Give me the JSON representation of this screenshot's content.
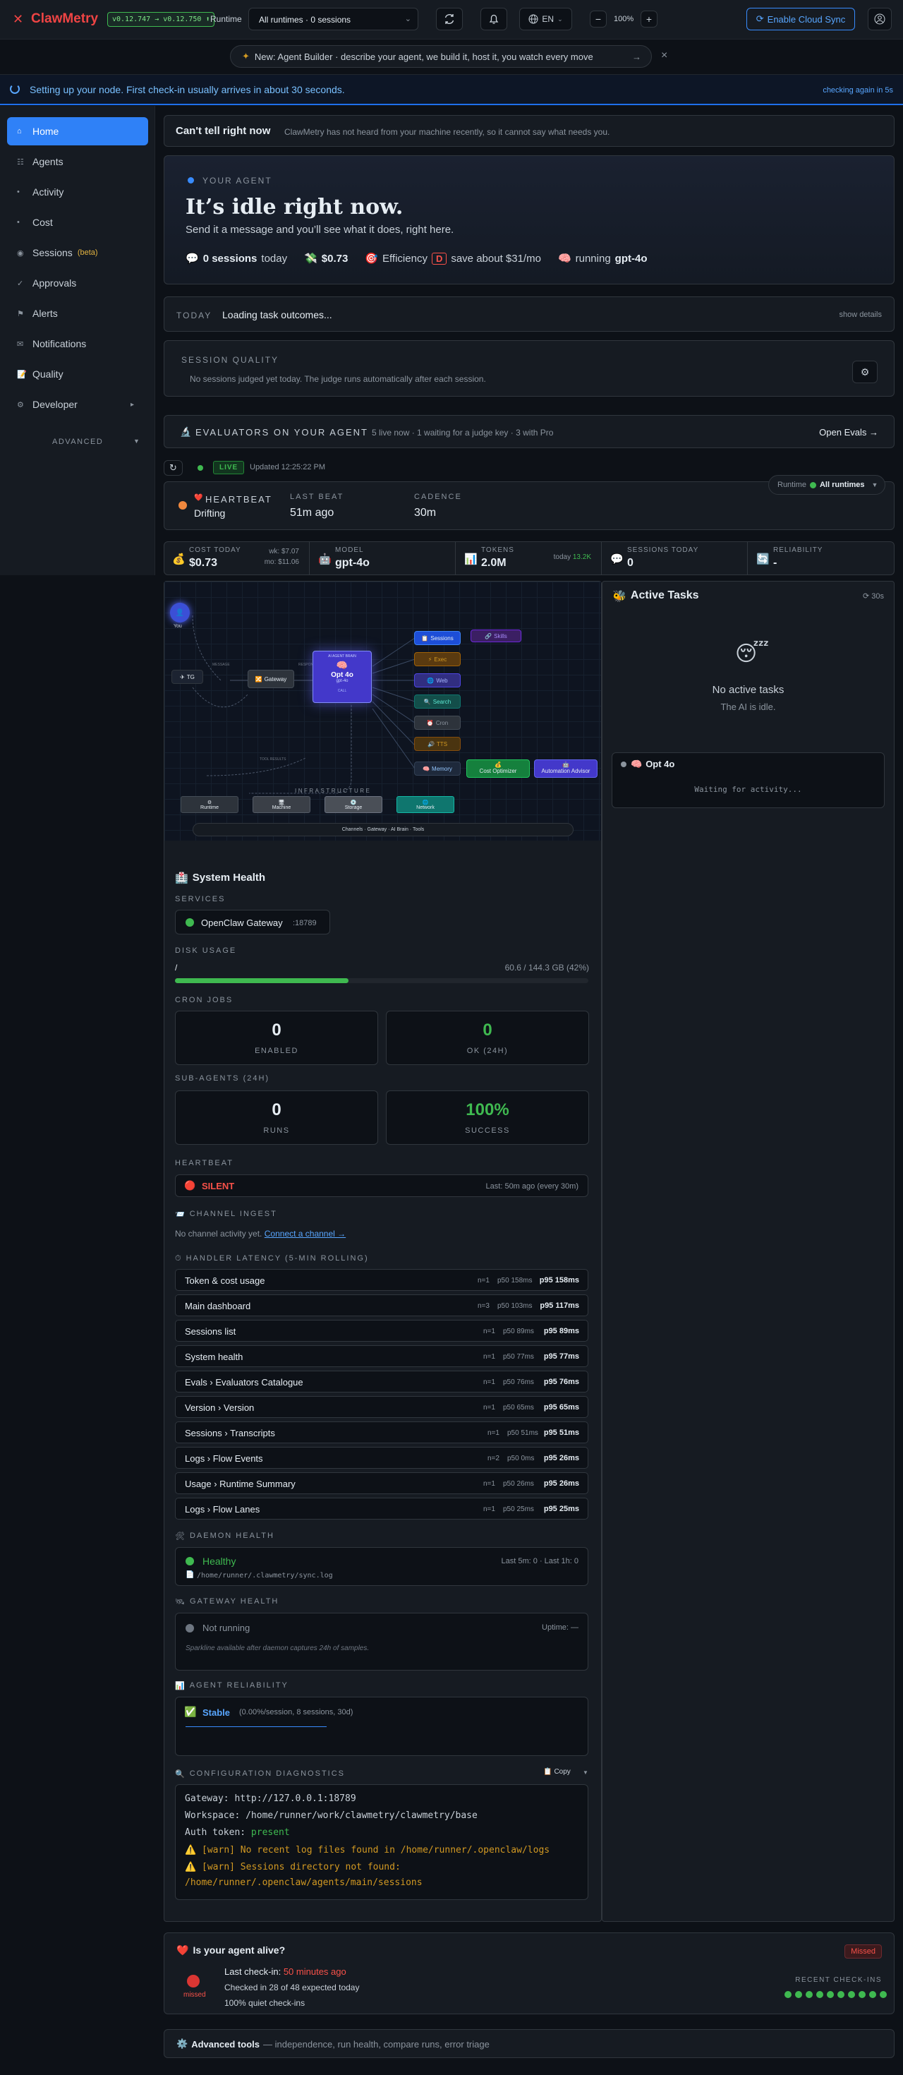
{
  "topbar": {
    "logo": "ClawMetry",
    "version": "v0.12.747 → v0.12.750 ⬆",
    "runtime_label": "Runtime",
    "runtime_select": "All runtimes · 0 sessions",
    "lang": "EN",
    "zoom": "100%",
    "zoom_minus": "−",
    "zoom_plus": "+",
    "cloud_sync": "Enable Cloud Sync"
  },
  "announce": {
    "text": "New: Agent Builder · describe your agent, we build it, host it, you watch every move",
    "arrow": "→",
    "close": "×"
  },
  "setup": {
    "text": "Setting up your node. First check-in usually arrives in about 30 seconds.",
    "right": "checking again in 5s"
  },
  "sidebar": {
    "items": [
      {
        "label": "Home",
        "icon": "home-icon",
        "glyph": "⌂"
      },
      {
        "label": "Agents",
        "icon": "agents-icon",
        "glyph": "☷"
      },
      {
        "label": "Activity",
        "icon": "activity-icon",
        "glyph": "•"
      },
      {
        "label": "Cost",
        "icon": "cost-icon",
        "glyph": "•"
      },
      {
        "label": "Sessions",
        "icon": "sessions-icon",
        "glyph": "◉",
        "badge": "(beta)"
      },
      {
        "label": "Approvals",
        "icon": "check-icon",
        "glyph": "✓"
      },
      {
        "label": "Alerts",
        "icon": "flag-icon",
        "glyph": "⚑"
      },
      {
        "label": "Notifications",
        "icon": "mail-icon",
        "glyph": "✉"
      },
      {
        "label": "Quality",
        "icon": "memo-icon",
        "glyph": "📝"
      },
      {
        "label": "Developer",
        "icon": "gear-icon",
        "glyph": "⚙"
      }
    ],
    "advanced": "ADVANCED"
  },
  "cant_tell": {
    "title": "Can't tell right now",
    "desc": "ClawMetry has not heard from your machine recently, so it cannot say what needs you."
  },
  "agent": {
    "label": "YOUR AGENT",
    "headline": "It’s idle right now.",
    "sub": "Send it a message and you’ll see what it does, right here.",
    "sessions_count": "0 sessions",
    "sessions_suffix": "today",
    "cost": "$0.73",
    "efficiency_label": "Efficiency",
    "efficiency_grade": "D",
    "save": "save about $31/mo",
    "running_label": "running",
    "model": "gpt-4o"
  },
  "today": {
    "label": "TODAY",
    "text": "Loading task outcomes...",
    "link": "show details"
  },
  "quality": {
    "label": "SESSION QUALITY",
    "text": "No sessions judged yet today. The judge runs automatically after each session."
  },
  "evaluators": {
    "label": "EVALUATORS ON YOUR AGENT",
    "desc": "5 live now · 1 waiting for a judge key · 3 with Pro",
    "link": "Open Evals →"
  },
  "status": {
    "live": "LIVE",
    "updated": "Updated 12:25:22 PM"
  },
  "heartbeat": {
    "label": "HEARTBEAT",
    "state": "Drifting",
    "last_beat_label": "LAST BEAT",
    "last_beat": "51m ago",
    "cadence_label": "CADENCE",
    "cadence": "30m",
    "runtime_label": "Runtime",
    "runtime_value": "All runtimes"
  },
  "stats": {
    "cost_label": "COST TODAY",
    "cost": "$0.73",
    "cost_wk": "wk: $7.07",
    "cost_mo": "mo: $11.06",
    "model_label": "MODEL",
    "model": "gpt-4o",
    "tokens_label": "TOKENS",
    "tokens": "2.0M",
    "tokens_today_label": "today",
    "tokens_today": "13.2K",
    "sessions_label": "SESSIONS TODAY",
    "sessions": "0",
    "reliability_label": "RELIABILITY",
    "reliability": "-"
  },
  "flow": {
    "user": "You",
    "tg": "TG",
    "gateway": "Gateway",
    "brain_caption": "AI AGENT BRAIN",
    "brain": "Opt 4o",
    "brain_model": "gpt-4o",
    "brain_link": "CALL",
    "gateway_caption": "MESSAGE",
    "brain_in": "RESPONSE",
    "bottom_caption": "TOOL RESULTS",
    "tools": [
      "Sessions",
      "Exec",
      "Web",
      "Search",
      "Cron",
      "TTS",
      "Memory"
    ],
    "extra_tool": "Skills",
    "cost_opt": "Cost Optimizer",
    "automation": "Automation Advisor",
    "infra_label": "INFRASTRUCTURE",
    "infra": [
      "Runtime",
      "Machine",
      "Storage",
      "Network"
    ],
    "legend": "Channels · Gateway · AI Brain · Tools"
  },
  "active_tasks": {
    "title": "Active Tasks",
    "refresh": "30s",
    "empty": "No active tasks",
    "empty_sub": "The AI is idle.",
    "agent": "Opt 4o",
    "waiting": "Waiting for activity..."
  },
  "system_health": {
    "title": "System Health",
    "services_label": "SERVICES",
    "service_name": "OpenClaw Gateway",
    "service_port": ":18789",
    "disk_label": "DISK USAGE",
    "disk_path": "/",
    "disk_value": "60.6 / 144.3 GB (42%)",
    "disk_percent": 42,
    "cron_label": "CRON JOBS",
    "cron_enabled": "0",
    "cron_enabled_label": "ENABLED",
    "cron_ok": "0",
    "cron_ok_label": "OK (24H)",
    "sub_label": "SUB-AGENTS (24H)",
    "sub_runs": "0",
    "sub_runs_label": "RUNS",
    "sub_success": "100%",
    "sub_success_label": "SUCCESS",
    "hb_label": "HEARTBEAT",
    "hb_state": "SILENT",
    "hb_last": "Last: 50m ago (every 30m)",
    "channel_label": "CHANNEL INGEST",
    "channel_text": "No channel activity yet.",
    "channel_link": "Connect a channel →",
    "latency_label": "HANDLER LATENCY (5-MIN ROLLING)",
    "latency": [
      {
        "name": "Token & cost usage",
        "n": "n=1",
        "p50": "p50 158ms",
        "p95": "p95 158ms"
      },
      {
        "name": "Main dashboard",
        "n": "n=3",
        "p50": "p50 103ms",
        "p95": "p95 117ms"
      },
      {
        "name": "Sessions list",
        "n": "n=1",
        "p50": "p50 89ms",
        "p95": "p95 89ms"
      },
      {
        "name": "System health",
        "n": "n=1",
        "p50": "p50 77ms",
        "p95": "p95 77ms"
      },
      {
        "name": "Evals › Evaluators Catalogue",
        "n": "n=1",
        "p50": "p50 76ms",
        "p95": "p95 76ms"
      },
      {
        "name": "Version › Version",
        "n": "n=1",
        "p50": "p50 65ms",
        "p95": "p95 65ms"
      },
      {
        "name": "Sessions › Transcripts",
        "n": "n=1",
        "p50": "p50 51ms",
        "p95": "p95 51ms"
      },
      {
        "name": "Logs › Flow Events",
        "n": "n=2",
        "p50": "p50 0ms",
        "p95": "p95 26ms"
      },
      {
        "name": "Usage › Runtime Summary",
        "n": "n=1",
        "p50": "p50 26ms",
        "p95": "p95 26ms"
      },
      {
        "name": "Logs › Flow Lanes",
        "n": "n=1",
        "p50": "p50 25ms",
        "p95": "p95 25ms"
      }
    ],
    "daemon_label": "DAEMON HEALTH",
    "daemon_state": "Healthy",
    "daemon_meta": "Last 5m: 0 · Last 1h: 0",
    "daemon_path": "/home/runner/.clawmetry/sync.log",
    "gw_label": "GATEWAY HEALTH",
    "gw_state": "Not running",
    "gw_uptime": "Uptime: —",
    "gw_note": "Sparkline available after daemon captures 24h of samples.",
    "rel_label": "AGENT RELIABILITY",
    "rel_state": "Stable",
    "rel_meta": "(0.00%/session, 8 sessions, 30d)",
    "cfg_label": "CONFIGURATION DIAGNOSTICS",
    "cfg_copy": "Copy",
    "cfg_gateway_k": "Gateway:",
    "cfg_gateway_v": "http://127.0.0.1:18789",
    "cfg_ws_k": "Workspace:",
    "cfg_ws_v": "/home/runner/work/clawmetry/clawmetry/base",
    "cfg_auth_k": "Auth token:",
    "cfg_auth_v": "present",
    "cfg_warn1": "[warn] No recent log files found in /home/runner/.openclaw/logs",
    "cfg_warn2a": "[warn] Sessions directory not found:",
    "cfg_warn2b": "/home/runner/.openclaw/agents/main/sessions"
  },
  "alive": {
    "title": "Is your agent alive?",
    "badge": "Missed",
    "missed": "missed",
    "last_label": "Last check-in:",
    "last_value": "50 minutes ago",
    "checked": "Checked in 28 of 48 expected today",
    "quiet": "100% quiet check-ins",
    "recent": "RECENT CHECK-INS"
  },
  "advanced_tools": {
    "title": "Advanced tools",
    "desc": "— independence, run health, compare runs, error triage"
  },
  "colors": {
    "accent": "#2f81f7",
    "danger": "#f85149",
    "success": "#3fb950",
    "warning": "#d29922"
  }
}
